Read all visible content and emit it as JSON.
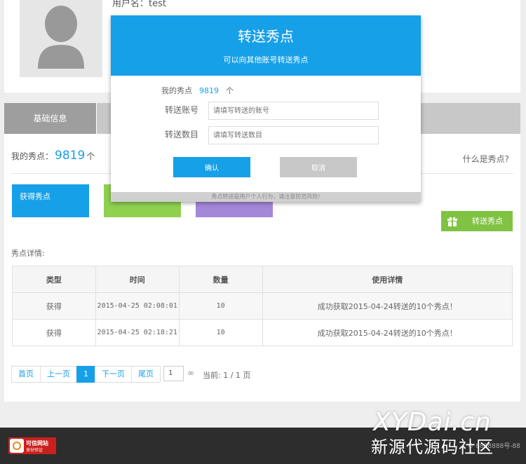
{
  "profile": {
    "username_label": "用户名：test"
  },
  "tabs": [
    {
      "label": "基础信息"
    }
  ],
  "points": {
    "label": "我的秀点：",
    "value": "9819",
    "unit": "个",
    "what_link": "什么是秀点?"
  },
  "blocks": [
    {
      "label": "获得秀点",
      "color": "#16a0e8"
    },
    {
      "label": "",
      "color": "#8fd14f"
    },
    {
      "label": "",
      "color": "#a587da"
    }
  ],
  "transfer_button": {
    "label": "转送秀点",
    "icon": "gift-icon",
    "color": "#80c342"
  },
  "detail": {
    "label": "秀点详情:",
    "columns": [
      "类型",
      "时间",
      "数量",
      "使用详情"
    ],
    "rows": [
      {
        "type": "获得",
        "time": "2015-04-25 02:08:01",
        "qty": "10",
        "desc": "成功获取2015-04-24转送的10个秀点！"
      },
      {
        "type": "获得",
        "time": "2015-04-25 02:18:21",
        "qty": "10",
        "desc": "成功获取2015-04-24转送的10个秀点！"
      }
    ]
  },
  "pager": {
    "first": "首页",
    "prev": "上一页",
    "current": "1",
    "next": "下一页",
    "last": "尾页",
    "goto_value": "1",
    "go_icon": "∞",
    "info": "当前: 1 / 1 页"
  },
  "modal": {
    "title": "转送秀点",
    "subtitle": "可以向其他账号转送秀点",
    "my_points_label": "我的秀点",
    "my_points_value": "9819",
    "my_points_unit": "个",
    "account_label": "转送账号",
    "account_placeholder": "请填写转送的账号",
    "amount_label": "转送数目",
    "amount_placeholder": "请填写转送数目",
    "confirm_label": "确认",
    "cancel_label": "取消",
    "footer_note": "秀点转送是用户个人行为，请注意防范风险!",
    "accent_color": "#16a0e8"
  },
  "footer": {
    "logo_line1": "可信网站",
    "logo_line2": "身份验证",
    "copyright": "© 8888888号-88",
    "watermark_1": "XYDai.cn",
    "watermark_2": "新源代源码社区"
  }
}
